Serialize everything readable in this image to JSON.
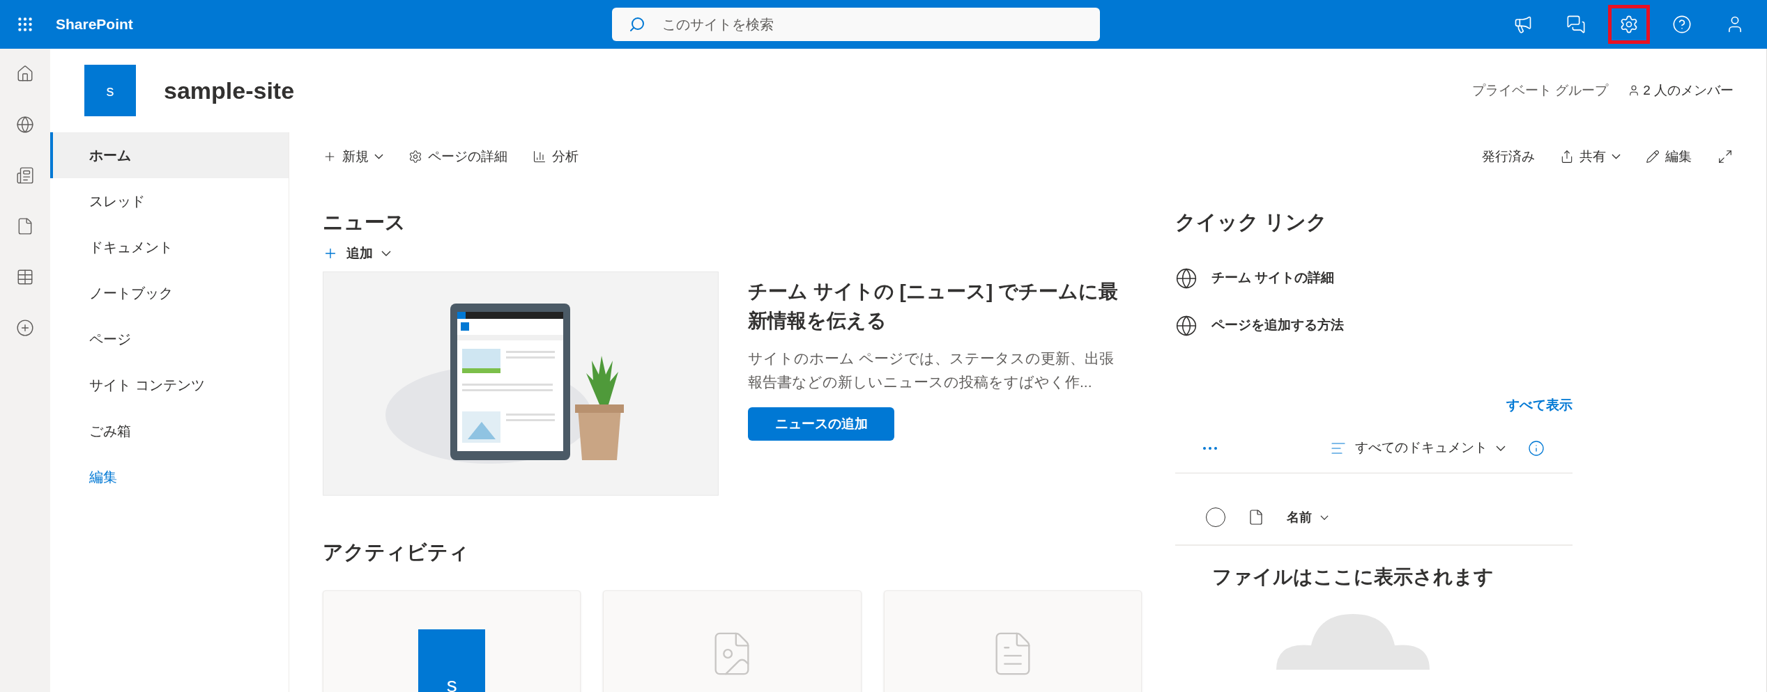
{
  "app": {
    "name": "SharePoint"
  },
  "search": {
    "placeholder": "このサイトを検索"
  },
  "header_icons": [
    {
      "kind": "megaphone",
      "highlighted": false
    },
    {
      "kind": "chat",
      "highlighted": false
    },
    {
      "kind": "settings",
      "highlighted": true
    },
    {
      "kind": "help",
      "highlighted": false
    },
    {
      "kind": "user",
      "highlighted": false
    }
  ],
  "rail": [
    {
      "kind": "home"
    },
    {
      "kind": "globe"
    },
    {
      "kind": "news"
    },
    {
      "kind": "file"
    },
    {
      "kind": "list"
    },
    {
      "kind": "add"
    }
  ],
  "site": {
    "logo": "s",
    "title": "sample-site",
    "privacy": "プライベート グループ",
    "members": "2 人のメンバー"
  },
  "nav": [
    {
      "label": "ホーム",
      "selected": true
    },
    {
      "label": "スレッド",
      "selected": false
    },
    {
      "label": "ドキュメント",
      "selected": false
    },
    {
      "label": "ノートブック",
      "selected": false
    },
    {
      "label": "ページ",
      "selected": false
    },
    {
      "label": "サイト コンテンツ",
      "selected": false
    },
    {
      "label": "ごみ箱",
      "selected": false
    }
  ],
  "nav_edit": "編集",
  "command_left": [
    {
      "kind": "new",
      "label": "新規",
      "dropdown": true
    },
    {
      "kind": "details",
      "label": "ページの詳細",
      "dropdown": false
    },
    {
      "kind": "analytics",
      "label": "分析",
      "dropdown": false
    }
  ],
  "command_right": [
    {
      "kind": "status",
      "label": "発行済み",
      "dropdown": false
    },
    {
      "kind": "share",
      "label": "共有",
      "dropdown": true
    },
    {
      "kind": "edit",
      "label": "編集",
      "dropdown": false
    }
  ],
  "news": {
    "title": "ニュース",
    "add": "追加",
    "headline": "チーム サイトの [ニュース] でチームに最新情報を伝える",
    "body": "サイトのホーム ページでは、ステータスの更新、出張報告書などの新しいニュースの投稿をすばやく作...",
    "button": "ニュースの追加"
  },
  "activity": {
    "title": "アクティビティ",
    "cards": [
      {
        "kind": "site",
        "logo": "s"
      },
      {
        "kind": "file"
      },
      {
        "kind": "document"
      }
    ]
  },
  "quick_links": {
    "title": "クイック リンク",
    "items": [
      "チーム サイトの詳細",
      "ページを追加する方法"
    ]
  },
  "documents": {
    "see_all": "すべて表示",
    "view": "すべてのドキュメント",
    "column": "名前",
    "select_all_checked": false,
    "empty": "ファイルはここに表示されます"
  }
}
